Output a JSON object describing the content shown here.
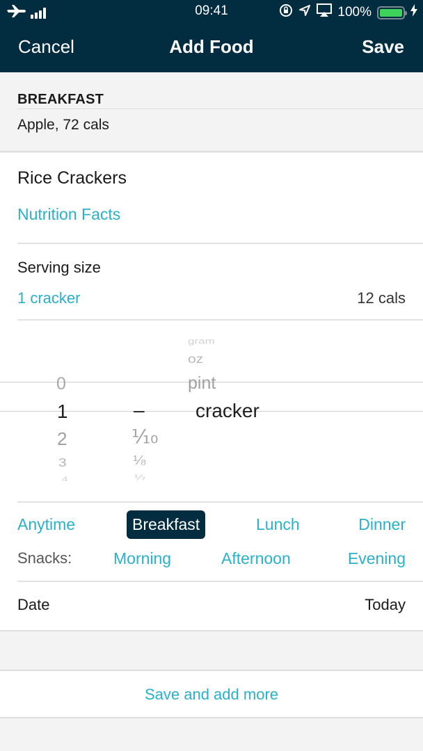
{
  "status_bar": {
    "time": "09:41",
    "battery": "100%",
    "battery_level": 1.0,
    "icons": [
      "airplane-icon",
      "signal-icon",
      "rotation-lock-icon",
      "location-icon",
      "airplay-icon",
      "battery-icon",
      "charging-icon"
    ]
  },
  "nav": {
    "cancel_label": "Cancel",
    "title": "Add Food",
    "save_label": "Save"
  },
  "meal_summary": {
    "label": "BREAKFAST",
    "item": "Apple, 72 cals"
  },
  "food": {
    "name": "Rice Crackers",
    "nutrition_link": "Nutrition Facts"
  },
  "serving": {
    "label": "Serving size",
    "value": "1 cracker",
    "calories": "12 cals"
  },
  "picker": {
    "whole_numbers": [
      "0",
      "1",
      "2",
      "3",
      "4"
    ],
    "whole_selected": "1",
    "fractions": [
      "–",
      "⅒",
      "⅛",
      "⅐"
    ],
    "fraction_selected": "–",
    "units": [
      "gram",
      "oz",
      "pint",
      "cracker"
    ],
    "unit_selected": "cracker"
  },
  "meals": {
    "options": [
      "Anytime",
      "Breakfast",
      "Lunch",
      "Dinner"
    ],
    "selected": "Breakfast",
    "snacks_label": "Snacks:",
    "snack_options": [
      "Morning",
      "Afternoon",
      "Evening"
    ]
  },
  "date": {
    "label": "Date",
    "value": "Today"
  },
  "save_more_label": "Save and add more",
  "colors": {
    "header_bg": "#022c40",
    "accent": "#2ab0c8",
    "battery": "#3dd25a"
  }
}
